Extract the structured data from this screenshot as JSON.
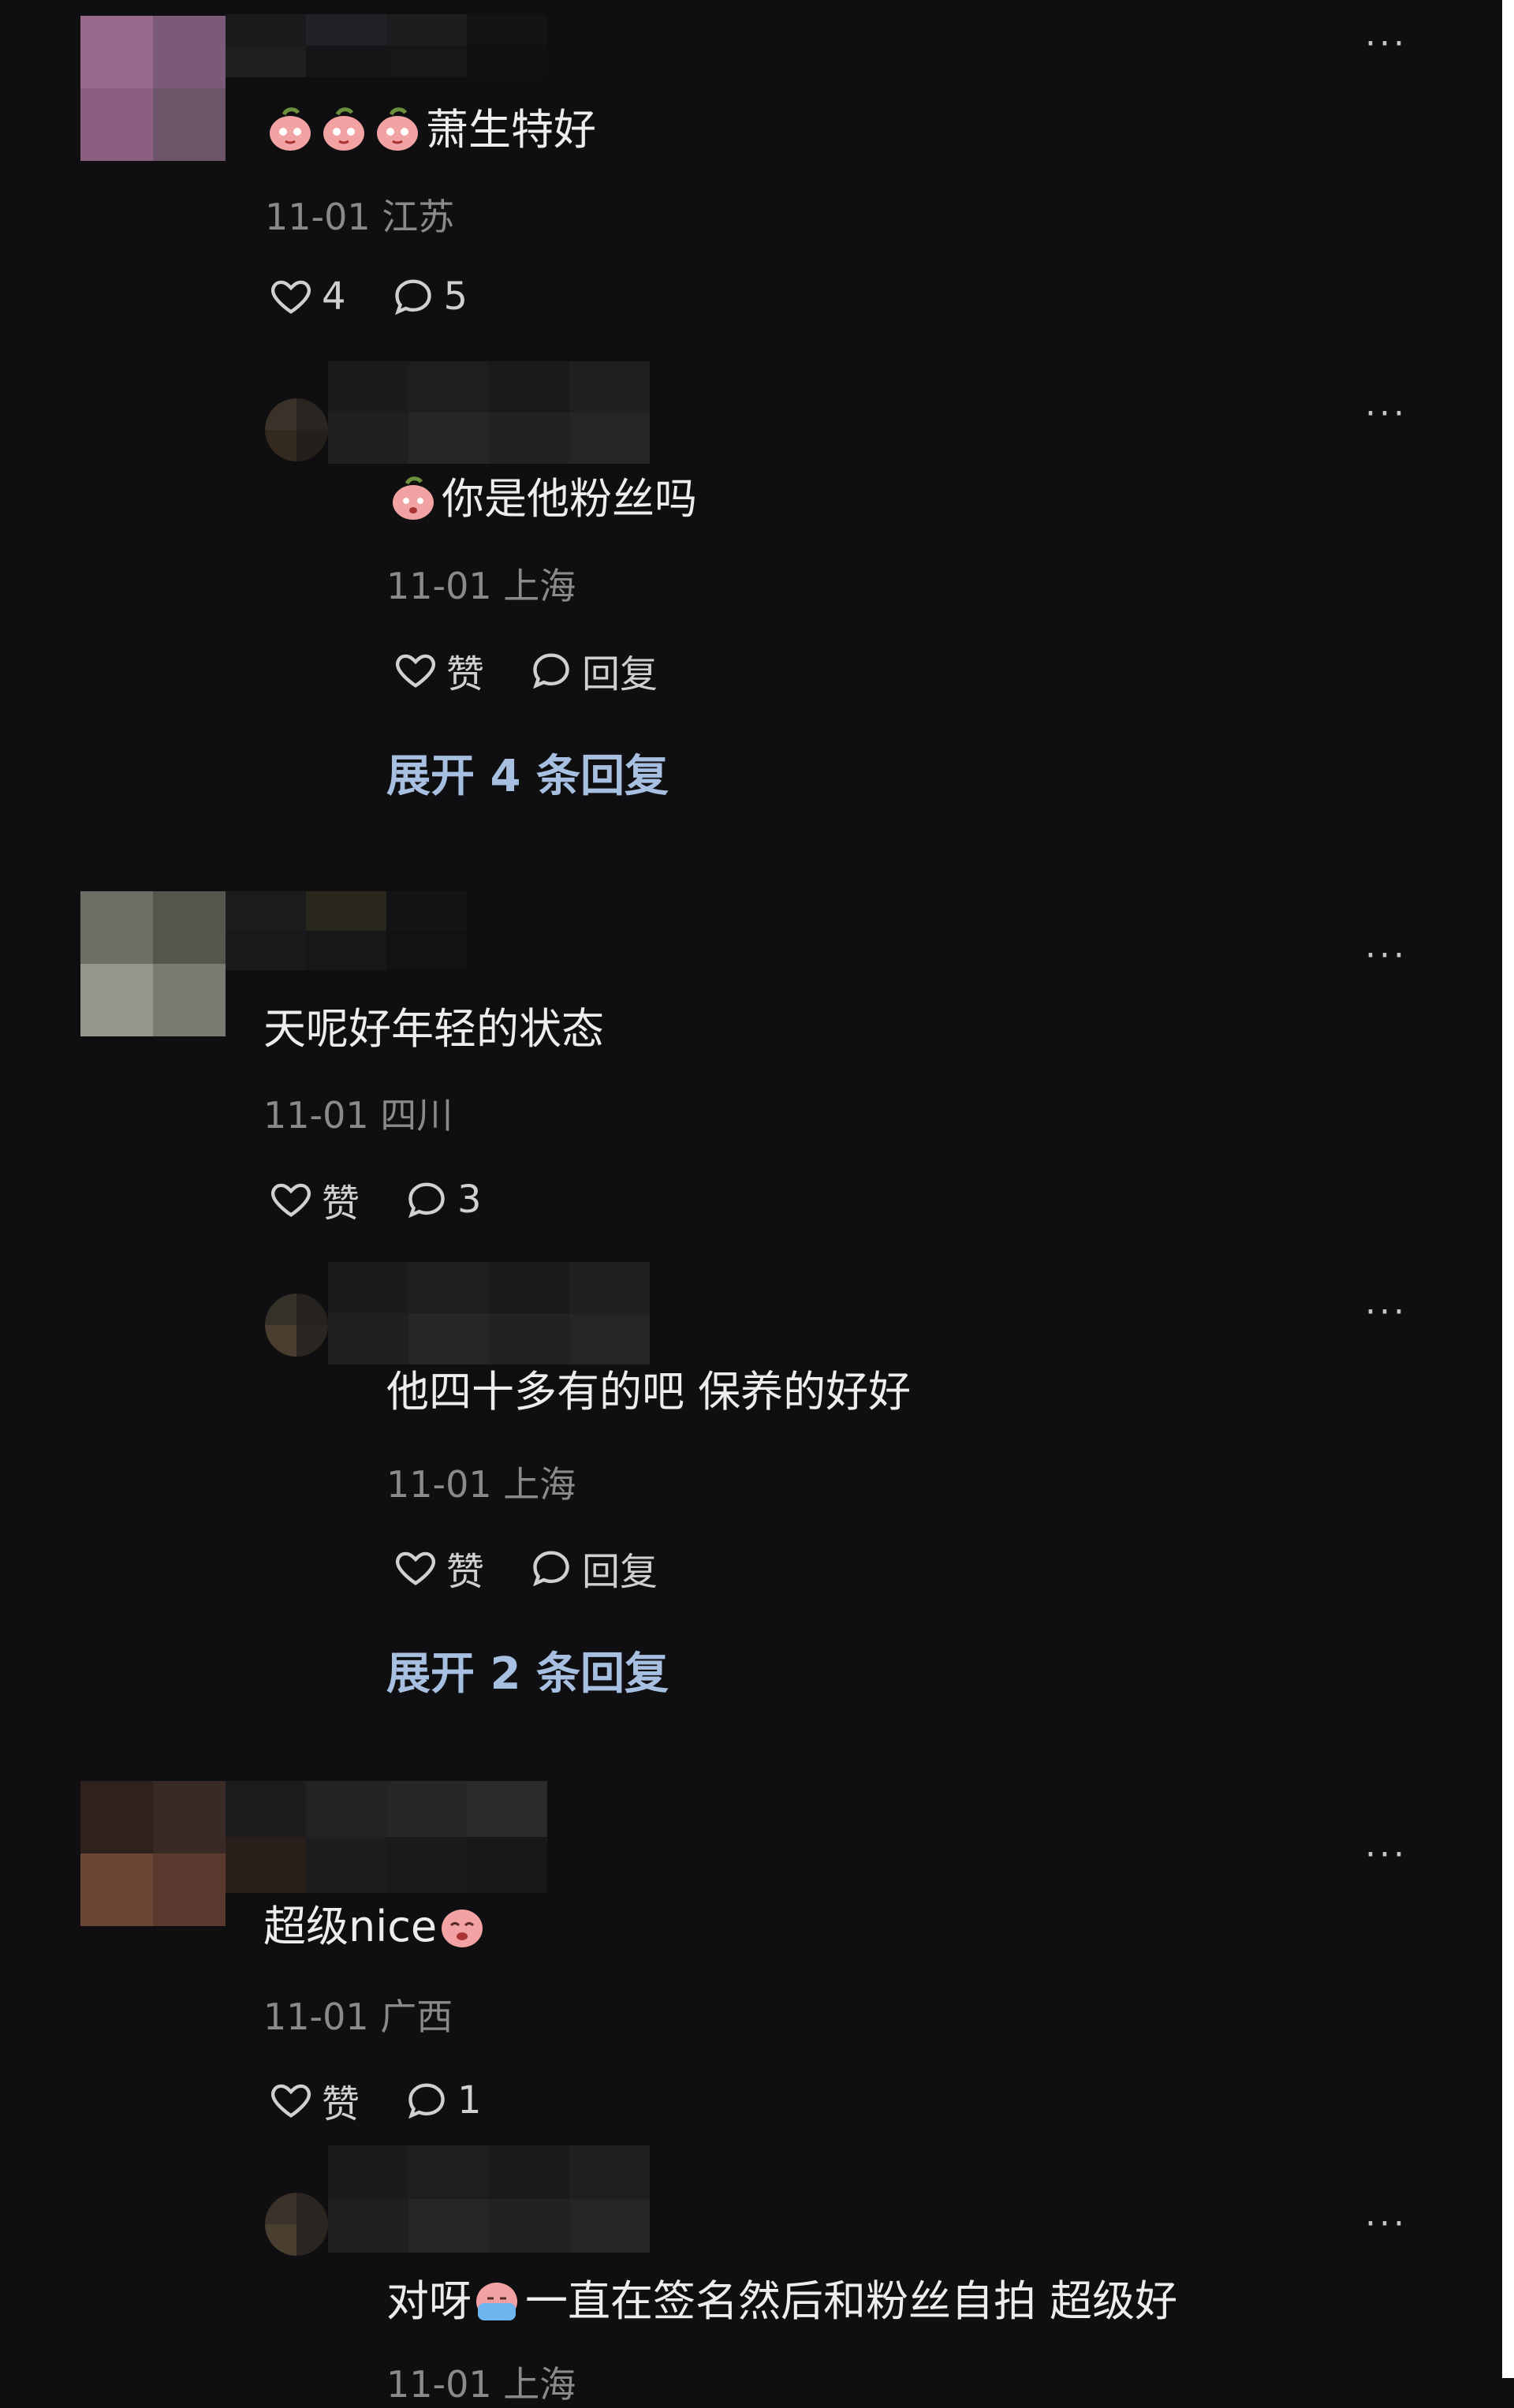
{
  "comments": [
    {
      "text": "萧生特好",
      "date": "11-01",
      "location": "江苏",
      "likes": "4",
      "replies_count": "5",
      "reply": {
        "text": "你是他粉丝吗",
        "date": "11-01",
        "location": "上海",
        "like_label": "赞",
        "reply_label": "回复",
        "expand_label": "展开 4 条回复"
      }
    },
    {
      "text": "天呢好年轻的状态",
      "date": "11-01",
      "location": "四川",
      "likes": "赞",
      "replies_count": "3",
      "reply": {
        "text": "他四十多有的吧 保养的好好",
        "date": "11-01",
        "location": "上海",
        "like_label": "赞",
        "reply_label": "回复",
        "expand_label": "展开 2 条回复"
      }
    },
    {
      "text": "超级nice",
      "date": "11-01",
      "location": "广西",
      "likes": "赞",
      "replies_count": "1",
      "reply": {
        "text_before": "对呀",
        "text_after": "一直在签名然后和粉丝自拍 超级好",
        "date": "11-01",
        "location": "上海"
      }
    }
  ],
  "more_label": "···",
  "icons": {
    "heart": "heart-icon",
    "comment": "comment-bubble-icon",
    "emoji_peach": "peach-emoji-icon",
    "emoji_sweat": "sweat-emoji-icon"
  },
  "colors": {
    "background": "#0f0f11",
    "text": "#ededed",
    "meta": "#8a8a8a",
    "link": "#a7bfe0"
  }
}
